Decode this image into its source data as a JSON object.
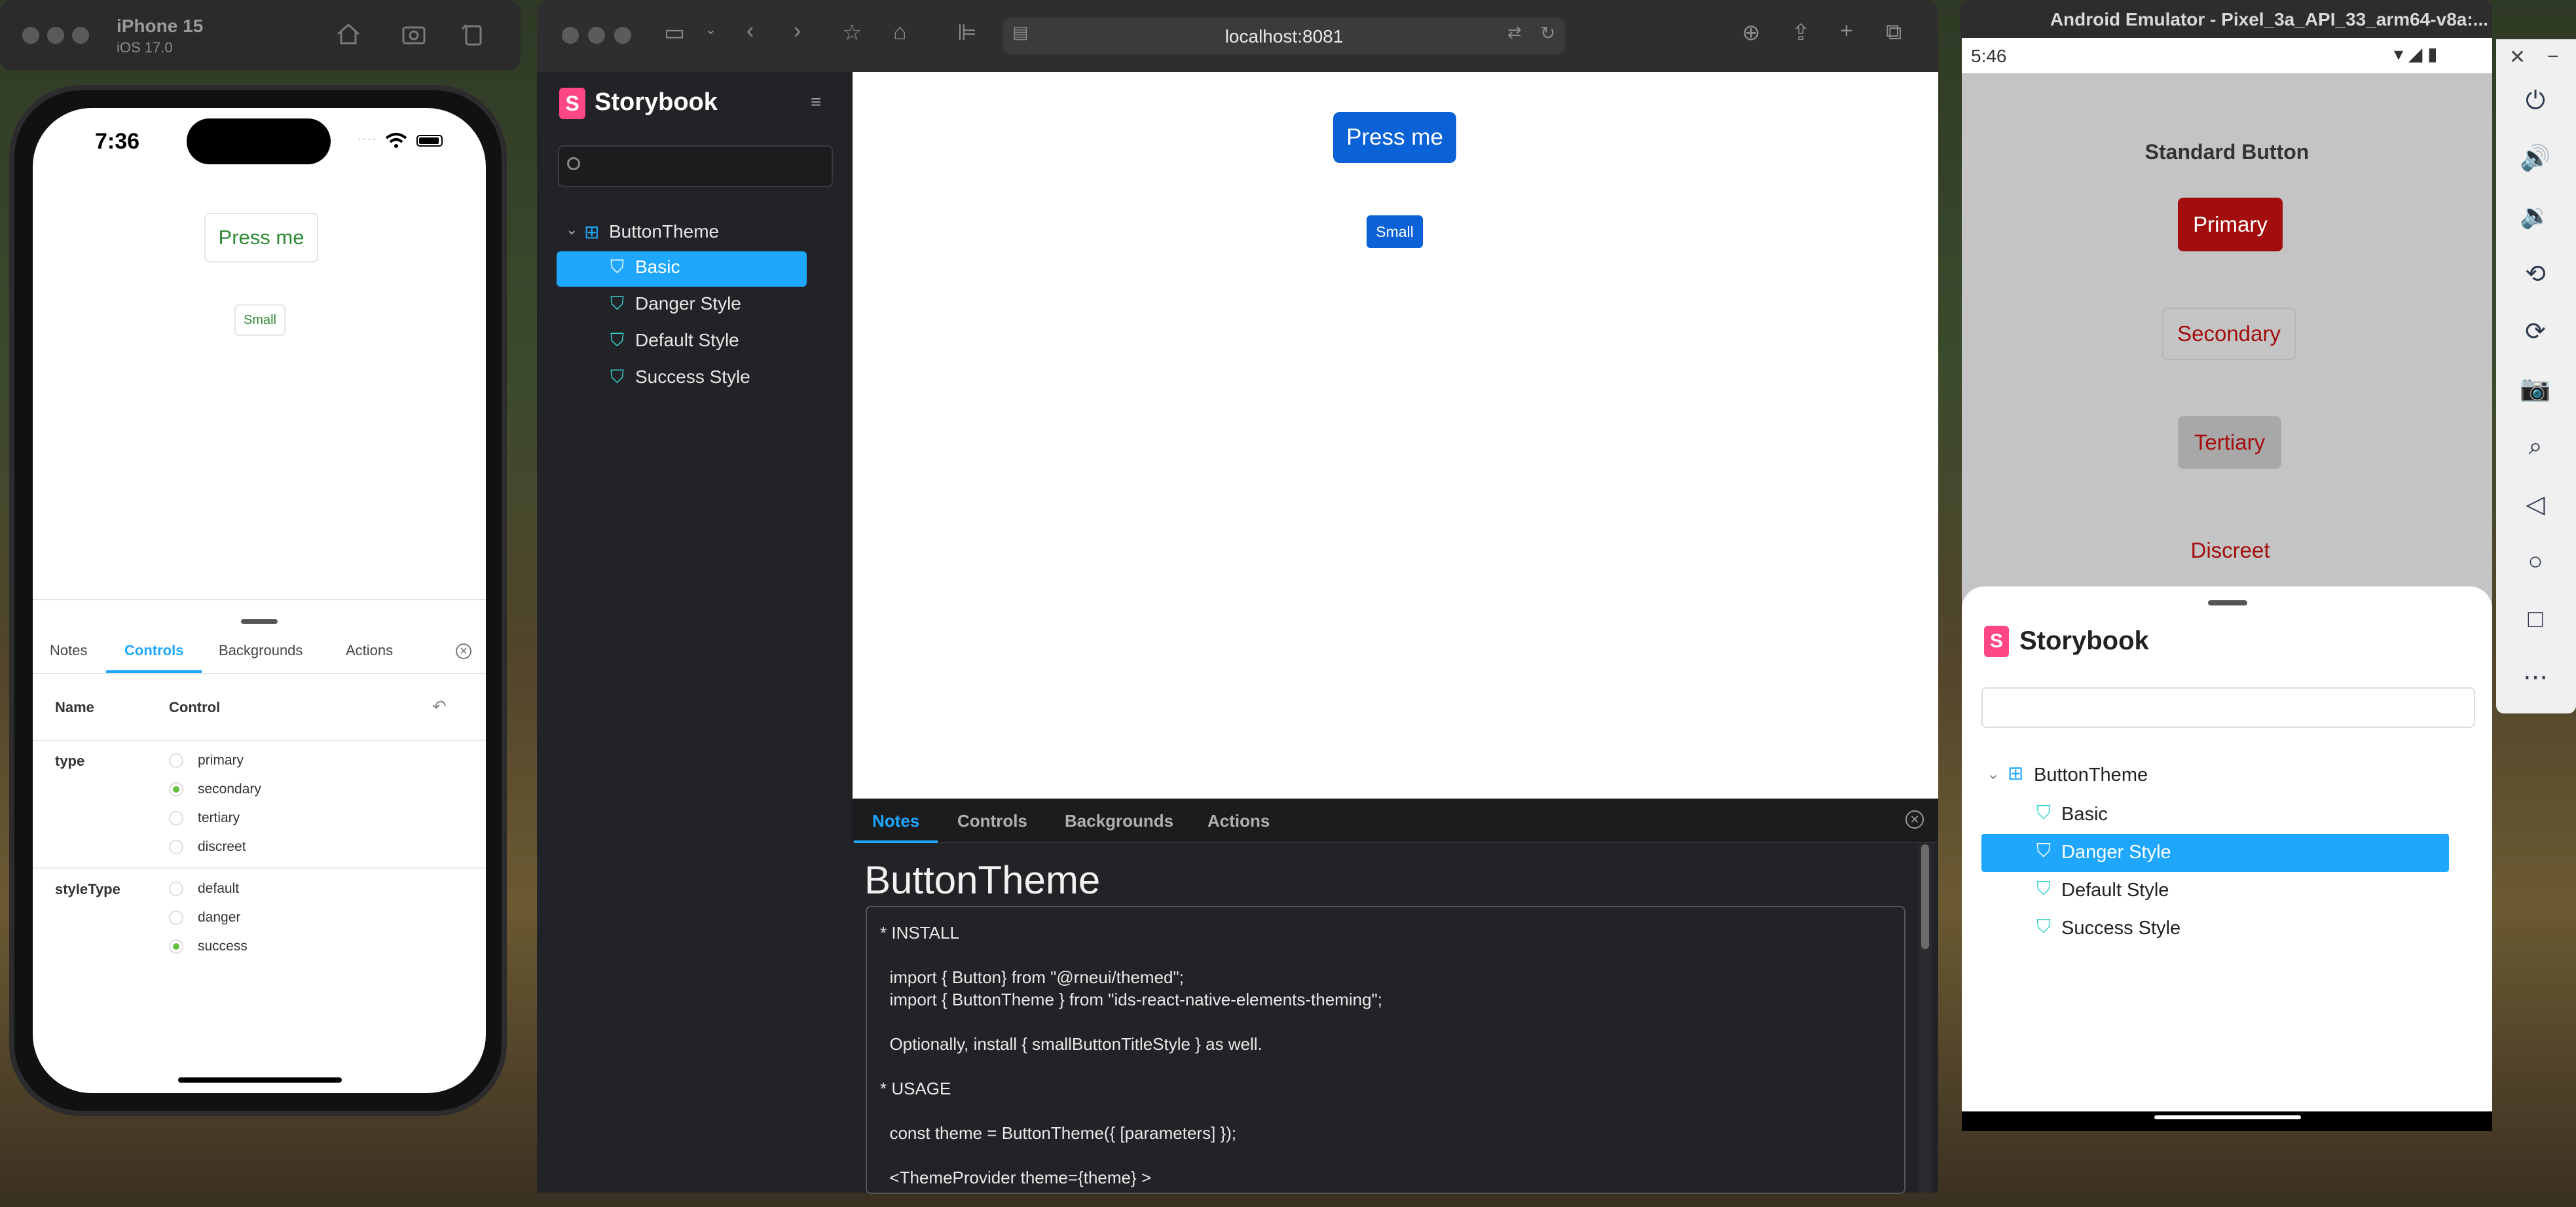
{
  "iphone": {
    "device_name": "iPhone 15",
    "os_version": "iOS 17.0",
    "status_time": "7:36",
    "status_dots": "....",
    "press_button": "Press me",
    "small_button": "Small",
    "tabs": [
      "Notes",
      "Controls",
      "Backgrounds",
      "Actions"
    ],
    "active_tab": "Controls",
    "table_headers": {
      "name": "Name",
      "control": "Control"
    },
    "props": [
      {
        "name": "type",
        "options": [
          "primary",
          "secondary",
          "tertiary",
          "discreet"
        ],
        "selected": "secondary"
      },
      {
        "name": "styleType",
        "options": [
          "default",
          "danger",
          "success"
        ],
        "selected": "success"
      }
    ],
    "accent": "#1ea7fd",
    "text_green": "#2f8a35"
  },
  "browser": {
    "url": "localhost:8081",
    "storybook_title": "Storybook",
    "tree": {
      "root": "ButtonTheme",
      "items": [
        "Basic",
        "Danger Style",
        "Default Style",
        "Success Style"
      ],
      "selected": "Basic"
    },
    "preview": {
      "press_button": "Press me",
      "small_button": "Small",
      "button_color": "#0a62d6"
    },
    "addon_tabs": [
      "Notes",
      "Controls",
      "Backgrounds",
      "Actions"
    ],
    "active_addon_tab": "Notes",
    "notes": {
      "title": "ButtonTheme",
      "lines": [
        "* INSTALL",
        "",
        "  import { Button} from \"@rneui/themed\";",
        "  import { ButtonTheme } from \"ids-react-native-elements-theming\";",
        "",
        "  Optionally, install { smallButtonTitleStyle } as well.",
        "",
        "* USAGE",
        "",
        "  const theme = ButtonTheme({ [parameters] });",
        "",
        "  <ThemeProvider theme={theme} >"
      ]
    }
  },
  "android": {
    "window_title": "Android Emulator - Pixel_3a_API_33_arm64-v8a:...",
    "status_time": "5:46",
    "section_title": "Standard Button",
    "buttons": [
      "Primary",
      "Secondary",
      "Tertiary",
      "Discreet"
    ],
    "danger_color": "#a30d0d",
    "storybook_title": "Storybook",
    "tree": {
      "root": "ButtonTheme",
      "items": [
        "Basic",
        "Danger Style",
        "Default Style",
        "Success Style"
      ],
      "selected": "Danger Style"
    }
  }
}
